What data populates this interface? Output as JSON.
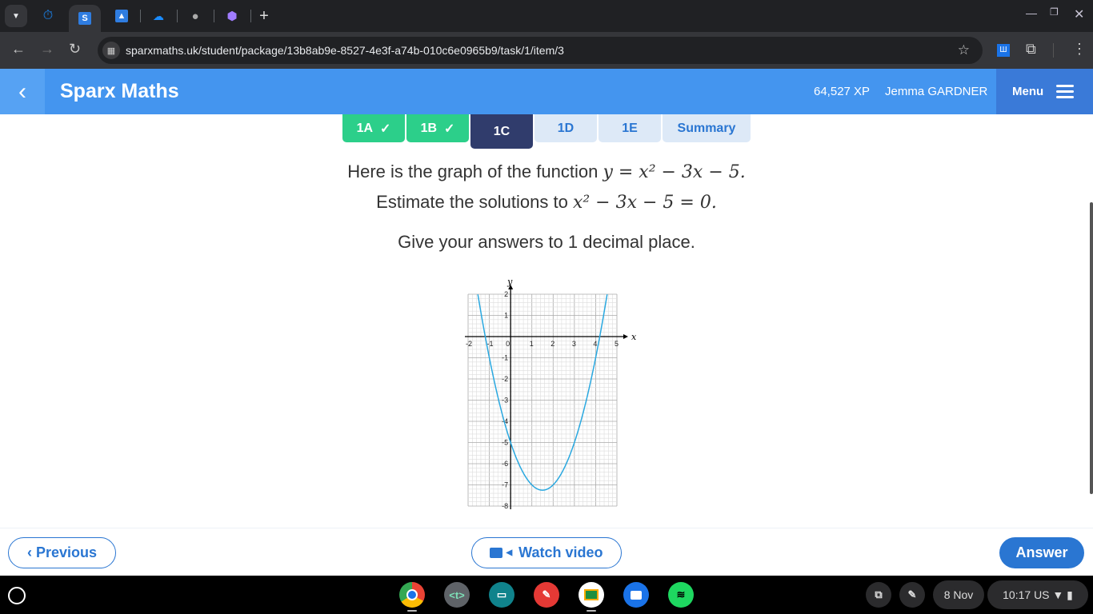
{
  "browser": {
    "tabs": [
      {
        "icon": "timer-icon",
        "active": false
      },
      {
        "icon": "sparx-s-icon",
        "label": "S",
        "active": true
      },
      {
        "icon": "classroom-contact-icon",
        "active": false
      },
      {
        "icon": "onedrive-cloud-icon",
        "active": false
      },
      {
        "icon": "globe-icon",
        "active": false
      },
      {
        "icon": "gem-extension-icon",
        "active": false
      }
    ],
    "new_tab": "+",
    "url": "sparxmaths.uk/student/package/13b8ab9e-8527-4e3f-a74b-010c6e0965b9/task/1/item/3",
    "window_controls": [
      "minimize",
      "restore",
      "close"
    ]
  },
  "app": {
    "title": "Sparx Maths",
    "xp": "64,527 XP",
    "user": "Jemma GARDNER",
    "menu_label": "Menu"
  },
  "task_tabs": [
    {
      "label": "1A",
      "state": "done"
    },
    {
      "label": "1B",
      "state": "done"
    },
    {
      "label": "1C",
      "state": "current"
    },
    {
      "label": "1D",
      "state": "todo"
    },
    {
      "label": "1E",
      "state": "todo"
    },
    {
      "label": "Summary",
      "state": "todo"
    }
  ],
  "question": {
    "line1_text": "Here is the graph of the function ",
    "line1_math": "y = x² − 3x − 5.",
    "line2_text": "Estimate the solutions to ",
    "line2_math": "x² − 3x − 5 = 0.",
    "line3": "Give your answers to 1 decimal place."
  },
  "chart_data": {
    "type": "line",
    "function": "y = x^2 - 3x - 5",
    "xlabel": "x",
    "ylabel": "y",
    "xlim": [
      -2,
      5
    ],
    "ylim": [
      -8,
      2
    ],
    "xticks": [
      -2,
      -1,
      0,
      1,
      2,
      3,
      4,
      5
    ],
    "yticks": [
      2,
      1,
      -1,
      -2,
      -3,
      -4,
      -5,
      -6,
      -7,
      -8
    ],
    "grid": true,
    "minor_grid_per_unit": 5,
    "series": [
      {
        "name": "y = x^2 - 3x - 5",
        "color": "#29a8e0",
        "coefficients": [
          1,
          -3,
          -5
        ]
      }
    ]
  },
  "footer": {
    "previous": "Previous",
    "watch_video": "Watch video",
    "answer": "Answer"
  },
  "shelf": {
    "apps": [
      "chrome-icon",
      "text-editor-icon",
      "news-icon",
      "canvas-paint-icon",
      "google-classroom-icon",
      "camera-icon",
      "spotify-icon"
    ],
    "date": "8 Nov",
    "time": "10:17",
    "locale": "US"
  }
}
